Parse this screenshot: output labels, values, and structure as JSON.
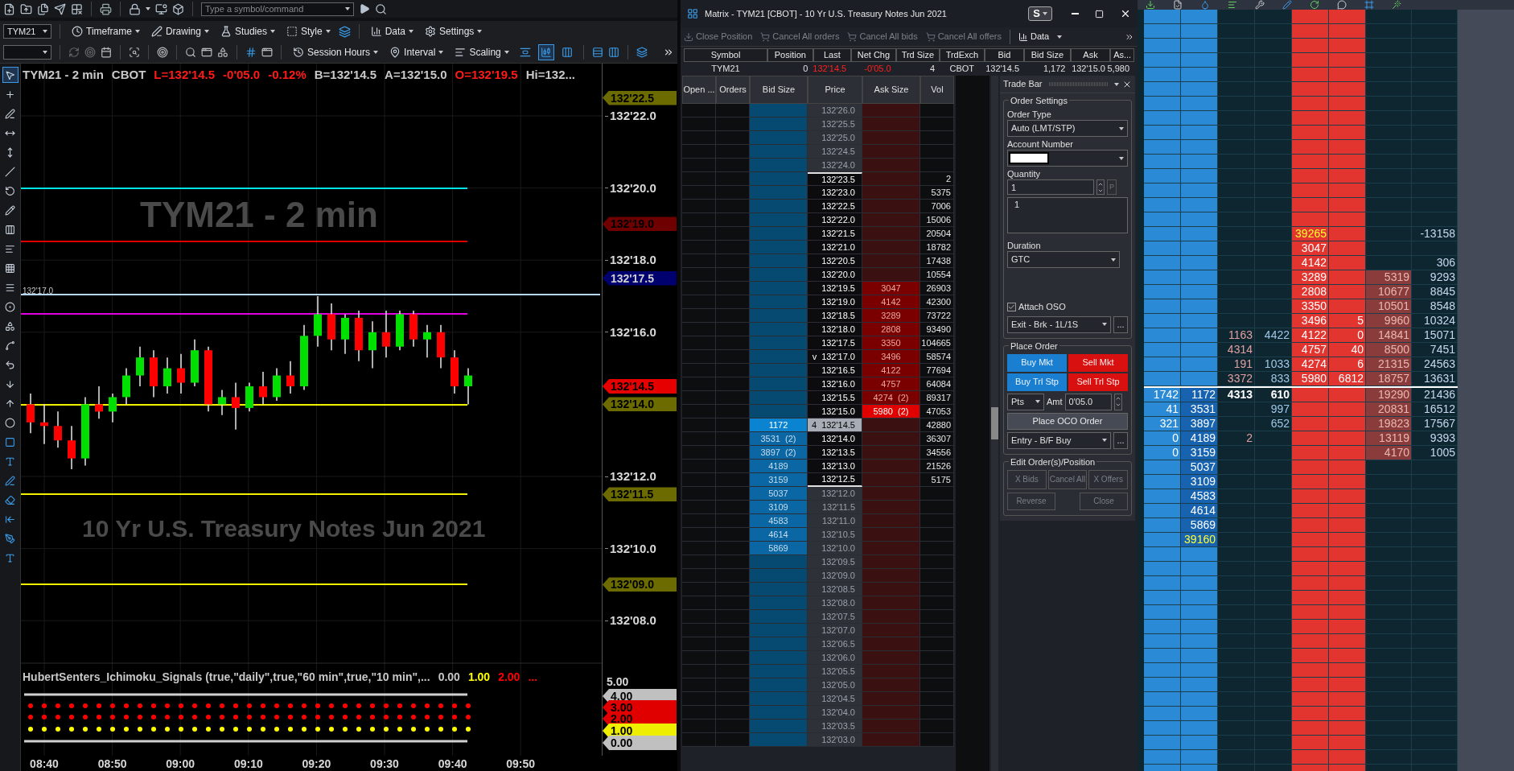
{
  "top_toolbar": {
    "command_placeholder": "Type a symbol/command"
  },
  "chart_toolbar": {
    "symbol": "TYM21",
    "menus": [
      "Timeframe",
      "Drawing",
      "Studies",
      "Style",
      "Data",
      "Settings"
    ],
    "second_row_menus": [
      "Session Hours",
      "Interval",
      "Scaling"
    ],
    "bar_style_buttons": [
      {
        "selected": false
      },
      {
        "selected": true
      },
      {
        "selected": false
      }
    ]
  },
  "drawing_tools": [
    {
      "selected": true
    },
    {
      "selected": false
    },
    {
      "selected": false
    },
    {
      "selected": false
    },
    {
      "selected": false
    },
    {
      "selected": false
    },
    {
      "selected": false
    },
    {
      "selected": false
    },
    {
      "selected": false
    },
    {
      "selected": false
    },
    {
      "selected": false
    },
    {
      "selected": false
    },
    {
      "selected": false
    },
    {
      "selected": false
    },
    {
      "selected": false
    },
    {
      "selected": false
    },
    {
      "selected": false
    },
    {
      "selected": false
    },
    {
      "selected": false
    },
    {
      "selected": false
    },
    {
      "selected": false
    },
    {
      "selected": false
    },
    {
      "selected": false
    },
    {
      "selected": false
    },
    {
      "selected": false
    },
    {
      "selected": false
    }
  ],
  "chart": {
    "quote_items": [
      {
        "text": "TYM21 - 2 min",
        "color": "#c8c8c8"
      },
      {
        "text": "CBOT",
        "color": "#c8c8c8"
      },
      {
        "text": "L=132'14.5",
        "color": "#ff1a1a"
      },
      {
        "text": "-0'05.0",
        "color": "#ff1a1a"
      },
      {
        "text": "-0.12%",
        "color": "#ff1a1a"
      },
      {
        "text": "B=132'14.5",
        "color": "#c8c8c8"
      },
      {
        "text": "A=132'15.0",
        "color": "#c8c8c8"
      },
      {
        "text": "O=132'19.5",
        "color": "#ff1a1a"
      },
      {
        "text": "Hi=132...",
        "color": "#c8c8c8"
      }
    ],
    "watermark": {
      "symbol": "TYM21 - 2 min",
      "description": "10 Yr U.S. Treasury Notes Jun 2021"
    },
    "line_label": "132'17.0",
    "price_axis": [
      "132'22.0",
      "132'20.0",
      "132'18.0",
      "132'16.0",
      "132'12.0",
      "132'10.0",
      "132'08.0"
    ],
    "price_tags": [
      {
        "text": "132'22.5",
        "color": "#6b6b00"
      },
      {
        "text": "132'19.0",
        "color": "#6e0000"
      },
      {
        "text": "132'17.5",
        "color": "#00006e"
      },
      {
        "text": "132'14.5",
        "color": "#e60000"
      },
      {
        "text": "132'14.0",
        "color": "#6b6b00"
      },
      {
        "text": "132'11.5",
        "color": "#6b6b00"
      },
      {
        "text": "132'09.0",
        "color": "#6b6b00"
      }
    ],
    "indicator": {
      "title": "HubertSenters_Ichimoku_Signals (true,\"daily\",true,\"60 min\",true,\"10 min\",...",
      "values": [
        {
          "text": "0.00",
          "color": "#c8c8c8"
        },
        {
          "text": "1.00",
          "color": "#ffff00"
        },
        {
          "text": "2.00",
          "color": "#ff0000"
        },
        {
          "text": "...",
          "color": "#ff0000"
        }
      ],
      "axis_label": "5.00",
      "tags": [
        {
          "text": "4.00",
          "color": "#c0c0c0"
        },
        {
          "text": "3.00",
          "color": "#e00000"
        },
        {
          "text": "2.00",
          "color": "#e00000"
        },
        {
          "text": "1.00",
          "color": "#eeee00"
        },
        {
          "text": "0.00",
          "color": "#c0c0c0"
        }
      ]
    },
    "time_axis": [
      "08:40",
      "08:50",
      "09:00",
      "09:10",
      "09:20",
      "09:30",
      "09:40",
      "09:50"
    ]
  },
  "matrix": {
    "title": "Matrix - TYM21 [CBOT] - 10 Yr U.S. Treasury Notes Jun 2021",
    "account_button": "S",
    "toolbar": [
      {
        "label": "Close Position",
        "disabled": true
      },
      {
        "label": "Cancel All orders",
        "disabled": true
      },
      {
        "label": "Cancel All bids",
        "disabled": true
      },
      {
        "label": "Cancel All offers",
        "disabled": true
      },
      {
        "label": "Data",
        "disabled": false
      }
    ],
    "quote_columns": [
      "Symbol",
      "Position",
      "Last",
      "Net Chg",
      "Trd Size",
      "TrdExch",
      "Bid",
      "Bid Size",
      "Ask",
      "As..."
    ],
    "quote_values": [
      {
        "text": "TYM21",
        "negative": false
      },
      {
        "text": "0",
        "negative": false
      },
      {
        "text": "132'14.5",
        "negative": true
      },
      {
        "text": "-0'05.0",
        "negative": true
      },
      {
        "text": "4",
        "negative": false
      },
      {
        "text": "CBOT",
        "negative": false
      },
      {
        "text": "132'14.5",
        "negative": false
      },
      {
        "text": "1,172",
        "negative": false
      },
      {
        "text": "132'15.0",
        "negative": false
      },
      {
        "text": "5,980",
        "negative": false
      }
    ],
    "ladder_columns": [
      "Open ...",
      "Orders",
      "Bid Size",
      "Price",
      "Ask Size",
      "Vol"
    ],
    "ladder_rows": [
      {
        "price": "132'26.0",
        "in_range": false,
        "kind": "plain"
      },
      {
        "price": "132'25.5",
        "in_range": false,
        "kind": "plain"
      },
      {
        "price": "132'25.0",
        "in_range": false,
        "kind": "plain"
      },
      {
        "price": "132'24.5",
        "in_range": false,
        "kind": "plain"
      },
      {
        "price": "132'24.0",
        "in_range": false,
        "kind": "plain"
      },
      {
        "price": "132'23.5",
        "vol": "2",
        "in_range": true,
        "kind": "plain"
      },
      {
        "price": "132'23.0",
        "vol": "5375",
        "in_range": true,
        "kind": "plain"
      },
      {
        "price": "132'22.5",
        "vol": "7006",
        "in_range": true,
        "kind": "plain"
      },
      {
        "price": "132'22.0",
        "vol": "15006",
        "in_range": true,
        "kind": "plain"
      },
      {
        "price": "132'21.5",
        "vol": "20504",
        "in_range": true,
        "kind": "plain"
      },
      {
        "price": "132'21.0",
        "vol": "18782",
        "in_range": true,
        "kind": "plain"
      },
      {
        "price": "132'20.5",
        "vol": "17438",
        "in_range": true,
        "kind": "plain"
      },
      {
        "price": "132'20.0",
        "vol": "10554",
        "in_range": true,
        "kind": "plain"
      },
      {
        "price": "132'19.5",
        "ask_size": "3047",
        "vol": "26903",
        "in_range": true,
        "kind": "plain"
      },
      {
        "price": "132'19.0",
        "ask_size": "4142",
        "vol": "42300",
        "in_range": true,
        "kind": "plain"
      },
      {
        "price": "132'18.5",
        "ask_size": "3289",
        "vol": "73722",
        "in_range": true,
        "kind": "plain"
      },
      {
        "price": "132'18.0",
        "ask_size": "2808",
        "vol": "93490",
        "in_range": true,
        "kind": "plain"
      },
      {
        "price": "132'17.5",
        "ask_size": "3350",
        "vol": "104665",
        "in_range": true,
        "kind": "plain"
      },
      {
        "price": "132'17.0",
        "marker": "v",
        "ask_size": "3496",
        "vol": "58574",
        "in_range": true,
        "kind": "plain"
      },
      {
        "price": "132'16.5",
        "ask_size": "4122",
        "vol": "77694",
        "in_range": true,
        "kind": "plain"
      },
      {
        "price": "132'16.0",
        "ask_size": "4757",
        "vol": "64084",
        "in_range": true,
        "kind": "plain"
      },
      {
        "price": "132'15.5",
        "ask_size": "4274  (2)",
        "vol": "89317",
        "in_range": true,
        "kind": "plain"
      },
      {
        "price": "132'15.0",
        "ask_size": "5980  (2)",
        "vol": "47053",
        "in_range": true,
        "kind": "best_ask"
      },
      {
        "price": "132'14.5",
        "last_size": "4",
        "bid_size": "1172",
        "vol": "42880",
        "in_range": true,
        "kind": "last"
      },
      {
        "price": "132'14.0",
        "bid_size": "3531  (2)",
        "vol": "36307",
        "in_range": true,
        "kind": "plain"
      },
      {
        "price": "132'13.5",
        "bid_size": "3897  (2)",
        "vol": "34556",
        "in_range": true,
        "kind": "plain"
      },
      {
        "price": "132'13.0",
        "bid_size": "4189",
        "vol": "21526",
        "in_range": true,
        "kind": "plain"
      },
      {
        "price": "132'12.5",
        "bid_size": "3159",
        "vol": "5175",
        "in_range": true,
        "kind": "plain"
      },
      {
        "price": "132'12.0",
        "bid_size": "5037",
        "in_range": false,
        "kind": "plain"
      },
      {
        "price": "132'11.5",
        "bid_size": "3109",
        "in_range": false,
        "kind": "plain"
      },
      {
        "price": "132'11.0",
        "bid_size": "4583",
        "in_range": false,
        "kind": "plain"
      },
      {
        "price": "132'10.5",
        "bid_size": "4614",
        "in_range": false,
        "kind": "plain"
      },
      {
        "price": "132'10.0",
        "bid_size": "5869",
        "in_range": false,
        "kind": "plain"
      },
      {
        "price": "132'09.5",
        "in_range": false,
        "kind": "plain"
      },
      {
        "price": "132'09.0",
        "in_range": false,
        "kind": "plain"
      },
      {
        "price": "132'08.5",
        "in_range": false,
        "kind": "plain"
      },
      {
        "price": "132'08.0",
        "in_range": false,
        "kind": "plain"
      },
      {
        "price": "132'07.5",
        "in_range": false,
        "kind": "plain"
      },
      {
        "price": "132'07.0",
        "in_range": false,
        "kind": "plain"
      },
      {
        "price": "132'06.5",
        "in_range": false,
        "kind": "plain"
      },
      {
        "price": "132'06.0",
        "in_range": false,
        "kind": "plain"
      },
      {
        "price": "132'05.5",
        "in_range": false,
        "kind": "plain"
      },
      {
        "price": "132'05.0",
        "in_range": false,
        "kind": "plain"
      },
      {
        "price": "132'04.5",
        "in_range": false,
        "kind": "plain"
      },
      {
        "price": "132'04.0",
        "in_range": false,
        "kind": "plain"
      },
      {
        "price": "132'03.5",
        "in_range": false,
        "kind": "plain"
      },
      {
        "price": "132'03.0",
        "in_range": false,
        "kind": "plain"
      }
    ],
    "trade_bar": {
      "title": "Trade Bar",
      "order_settings": "Order Settings",
      "order_type_label": "Order Type",
      "order_type": "Auto (LMT/STP)",
      "account_label": "Account Number",
      "quantity_label": "Quantity",
      "quantity": "1",
      "price_button": "P",
      "quantity_list": "1",
      "duration_label": "Duration",
      "duration": "GTC",
      "attach_oso": {
        "label": "Attach OSO",
        "checked": true
      },
      "oso_strategy": "Exit - Brk - 1L/1S",
      "more_button": "...",
      "place_order": "Place Order",
      "order_buttons": [
        {
          "label": "Buy Mkt",
          "kind": "buy"
        },
        {
          "label": "Sell Mkt",
          "kind": "sell"
        },
        {
          "label": "Buy Trl Stp",
          "kind": "buy"
        },
        {
          "label": "Sell Trl Stp",
          "kind": "sell"
        }
      ],
      "trail_unit": "Pts",
      "amount_label": "Amt",
      "amount": "0'05.0",
      "oco_button": "Place OCO Order",
      "entry_strategy": "Entry - B/F Buy",
      "entry_more_button": "...",
      "edit_group": "Edit Order(s)/Position",
      "edit_buttons": [
        {
          "label": "X Bids",
          "disabled": true
        },
        {
          "label": "Cancel All",
          "disabled": true
        },
        {
          "label": "X Offers",
          "disabled": true
        },
        {
          "label": "Reverse",
          "disabled": true
        },
        {
          "label": "Close",
          "disabled": true
        }
      ]
    }
  },
  "order_flow": {
    "rows": [
      {
        "current": false,
        "column_5": {
          "text": "39265",
          "highlighted": true
        },
        "column_8": {
          "text": "-13158",
          "highlighted": false
        }
      },
      {
        "current": false,
        "column_5": {
          "text": "3047",
          "highlighted": false
        }
      },
      {
        "current": false,
        "column_5": {
          "text": "4142",
          "highlighted": false
        },
        "column_8": {
          "text": "306",
          "highlighted": false
        }
      },
      {
        "current": false,
        "column_5": {
          "text": "3289",
          "highlighted": false
        },
        "column_7": {
          "text": "5319",
          "highlighted": false
        },
        "column_8": {
          "text": "9293",
          "highlighted": false
        }
      },
      {
        "current": false,
        "column_5": {
          "text": "2808",
          "highlighted": false
        },
        "column_7": {
          "text": "10677",
          "highlighted": false
        },
        "column_8": {
          "text": "8845",
          "highlighted": false
        }
      },
      {
        "current": false,
        "column_5": {
          "text": "3350",
          "highlighted": false
        },
        "column_7": {
          "text": "10501",
          "highlighted": false
        },
        "column_8": {
          "text": "8548",
          "highlighted": false
        }
      },
      {
        "current": false,
        "column_5": {
          "text": "3496",
          "highlighted": false
        },
        "column_6": {
          "text": "5",
          "highlighted": false
        },
        "column_7": {
          "text": "9960",
          "highlighted": false
        },
        "column_8": {
          "text": "10324",
          "highlighted": false
        }
      },
      {
        "current": false,
        "column_3": {
          "text": "1163",
          "highlighted": false
        },
        "column_4": {
          "text": "4422",
          "highlighted": false
        },
        "column_5": {
          "text": "4122",
          "highlighted": false
        },
        "column_6": {
          "text": "0",
          "highlighted": false
        },
        "column_7": {
          "text": "14841",
          "highlighted": false
        },
        "column_8": {
          "text": "15071",
          "highlighted": false
        }
      },
      {
        "current": false,
        "column_3": {
          "text": "4314",
          "highlighted": false
        },
        "column_5": {
          "text": "4757",
          "highlighted": false
        },
        "column_6": {
          "text": "40",
          "highlighted": false
        },
        "column_7": {
          "text": "8500",
          "highlighted": false
        },
        "column_8": {
          "text": "7451",
          "highlighted": false
        }
      },
      {
        "current": false,
        "column_3": {
          "text": "191",
          "highlighted": false
        },
        "column_4": {
          "text": "1033",
          "highlighted": false
        },
        "column_5": {
          "text": "4274",
          "highlighted": false
        },
        "column_6": {
          "text": "6",
          "highlighted": false
        },
        "column_7": {
          "text": "21315",
          "highlighted": false
        },
        "column_8": {
          "text": "24563",
          "highlighted": false
        }
      },
      {
        "current": false,
        "column_3": {
          "text": "3372",
          "highlighted": false
        },
        "column_4": {
          "text": "833",
          "highlighted": false
        },
        "column_5": {
          "text": "5980",
          "highlighted": false
        },
        "column_6": {
          "text": "6812",
          "highlighted": false
        },
        "column_7": {
          "text": "18757",
          "highlighted": false
        },
        "column_8": {
          "text": "13631",
          "highlighted": false
        }
      },
      {
        "current": true,
        "column_1": {
          "text": "1742",
          "highlighted": false
        },
        "column_2": {
          "text": "1172",
          "highlighted": false
        },
        "column_3": {
          "text": "4313",
          "highlighted": false
        },
        "column_4": {
          "text": "610",
          "highlighted": false
        },
        "column_7": {
          "text": "19290",
          "highlighted": false
        },
        "column_8": {
          "text": "21436",
          "highlighted": false
        }
      },
      {
        "current": false,
        "column_1": {
          "text": "41",
          "highlighted": false
        },
        "column_2": {
          "text": "3531",
          "highlighted": false
        },
        "column_4": {
          "text": "997",
          "highlighted": false
        },
        "column_7": {
          "text": "20831",
          "highlighted": false
        },
        "column_8": {
          "text": "16512",
          "highlighted": false
        }
      },
      {
        "current": false,
        "column_1": {
          "text": "321",
          "highlighted": false
        },
        "column_2": {
          "text": "3897",
          "highlighted": false
        },
        "column_4": {
          "text": "652",
          "highlighted": false
        },
        "column_7": {
          "text": "19823",
          "highlighted": false
        },
        "column_8": {
          "text": "17567",
          "highlighted": false
        }
      },
      {
        "current": false,
        "column_1": {
          "text": "0",
          "highlighted": false
        },
        "column_2": {
          "text": "4189",
          "highlighted": false
        },
        "column_3": {
          "text": "2",
          "highlighted": false
        },
        "column_7": {
          "text": "13119",
          "highlighted": false
        },
        "column_8": {
          "text": "9393",
          "highlighted": false
        }
      },
      {
        "current": false,
        "column_1": {
          "text": "0",
          "highlighted": false
        },
        "column_2": {
          "text": "3159",
          "highlighted": false
        },
        "column_7": {
          "text": "4170",
          "highlighted": false
        },
        "column_8": {
          "text": "1005",
          "highlighted": false
        }
      },
      {
        "current": false,
        "column_2": {
          "text": "5037",
          "highlighted": false
        }
      },
      {
        "current": false,
        "column_2": {
          "text": "3109",
          "highlighted": false
        }
      },
      {
        "current": false,
        "column_2": {
          "text": "4583",
          "highlighted": false
        }
      },
      {
        "current": false,
        "column_2": {
          "text": "4614",
          "highlighted": false
        }
      },
      {
        "current": false,
        "column_2": {
          "text": "5869",
          "highlighted": false
        }
      },
      {
        "current": false,
        "column_2": {
          "text": "39160",
          "highlighted": true
        }
      }
    ]
  }
}
